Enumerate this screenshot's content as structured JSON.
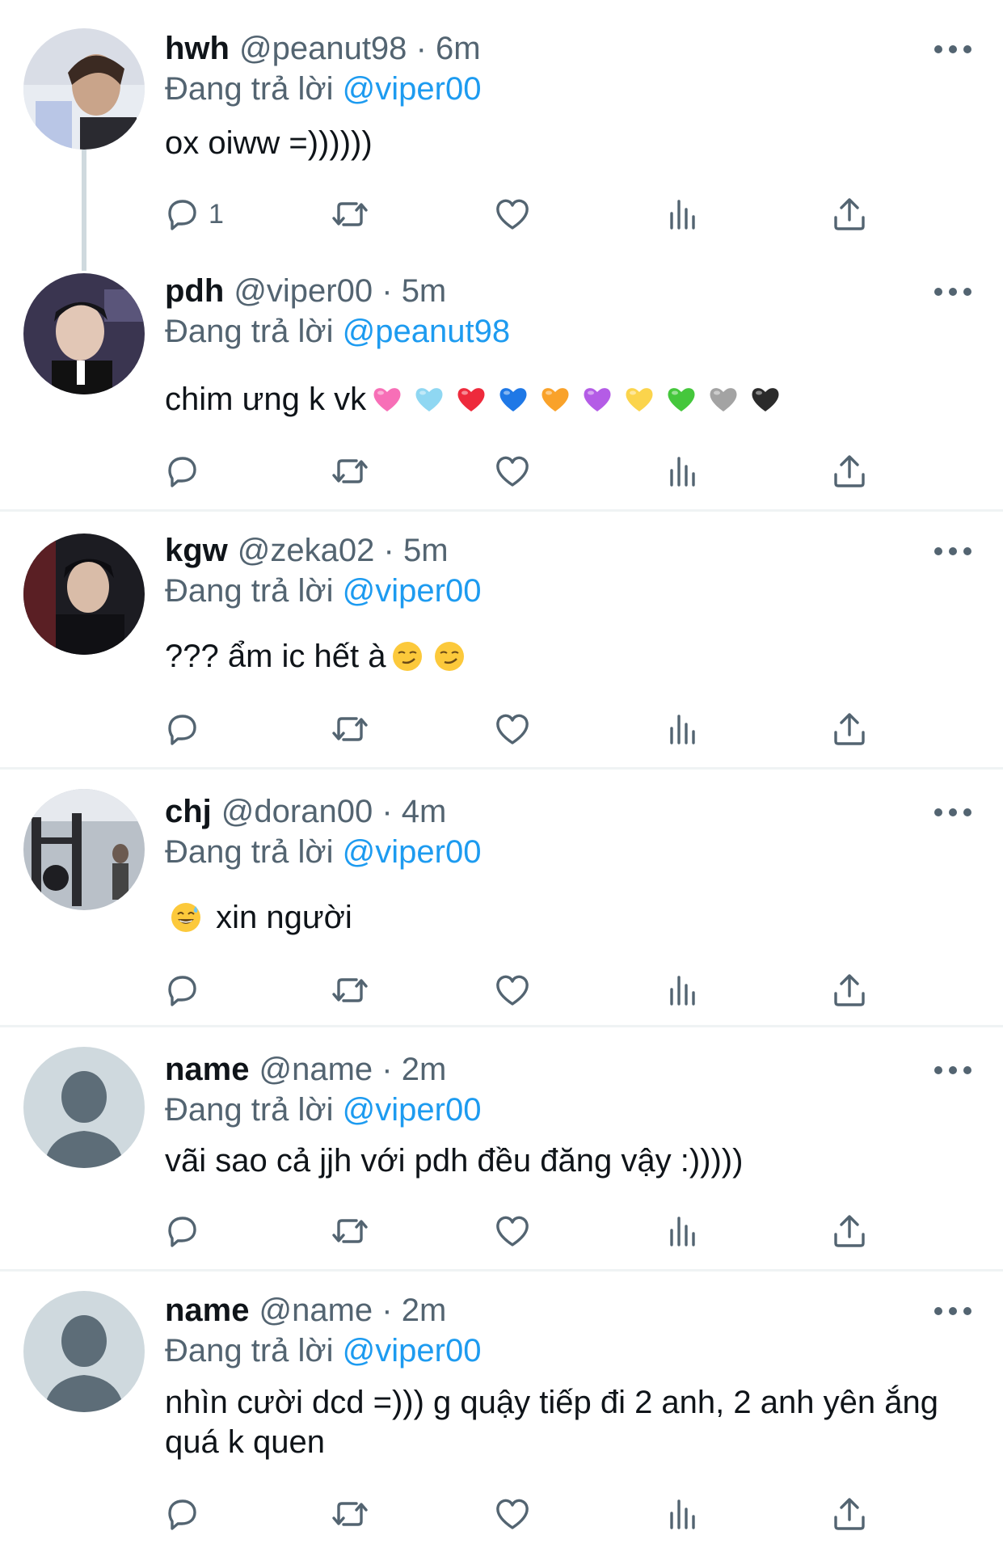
{
  "colors": {
    "text": "#0f1419",
    "muted": "#536471",
    "link": "#1d9bf0",
    "divider": "#eff3f4",
    "thread_line": "#cfd9de"
  },
  "replying_prefix": "Đang trả lời",
  "tweets": [
    {
      "name": "hwh",
      "handle": "@peanut98",
      "dot": "·",
      "time": "6m",
      "mention": "@viper00",
      "text": "ox oiww =))))))",
      "reply_count": "1",
      "avatar_icon": "user-photo-avatar"
    },
    {
      "name": "pdh",
      "handle": "@viper00",
      "dot": "·",
      "time": "5m",
      "mention": "@peanut98",
      "text": "chim ưng k vk",
      "emojis": [
        "pink-heart",
        "light-blue-heart",
        "red-heart",
        "blue-heart",
        "orange-heart",
        "purple-heart",
        "yellow-heart",
        "green-heart",
        "grey-heart",
        "black-heart"
      ],
      "reply_count": "",
      "avatar_icon": "user-photo-avatar"
    },
    {
      "name": "kgw",
      "handle": "@zeka02",
      "dot": "·",
      "time": "5m",
      "mention": "@viper00",
      "text": "??? ẩm ic hết à",
      "emojis": [
        "smirking-face",
        "smirking-face"
      ],
      "reply_count": "",
      "avatar_icon": "user-photo-avatar"
    },
    {
      "name": "chj",
      "handle": "@doran00",
      "dot": "·",
      "time": "4m",
      "mention": "@viper00",
      "text": "xin người",
      "emojis_before": [
        "grinning-sweat-face"
      ],
      "reply_count": "",
      "avatar_icon": "gym-photo-avatar"
    },
    {
      "name": "name",
      "handle": "@name",
      "dot": "·",
      "time": "2m",
      "mention": "@viper00",
      "text": "vãi sao cả jjh với pdh đều đăng vậy :)))))",
      "reply_count": "",
      "avatar_icon": "default-user-avatar"
    },
    {
      "name": "name",
      "handle": "@name",
      "dot": "·",
      "time": "2m",
      "mention": "@viper00",
      "text": "nhìn cười dcd =))) g quậy tiếp đi 2 anh, 2 anh yên ắng quá k quen",
      "reply_count": "",
      "avatar_icon": "default-user-avatar"
    }
  ],
  "action_icons": [
    "reply-icon",
    "retweet-icon",
    "like-icon",
    "views-icon",
    "share-icon"
  ]
}
